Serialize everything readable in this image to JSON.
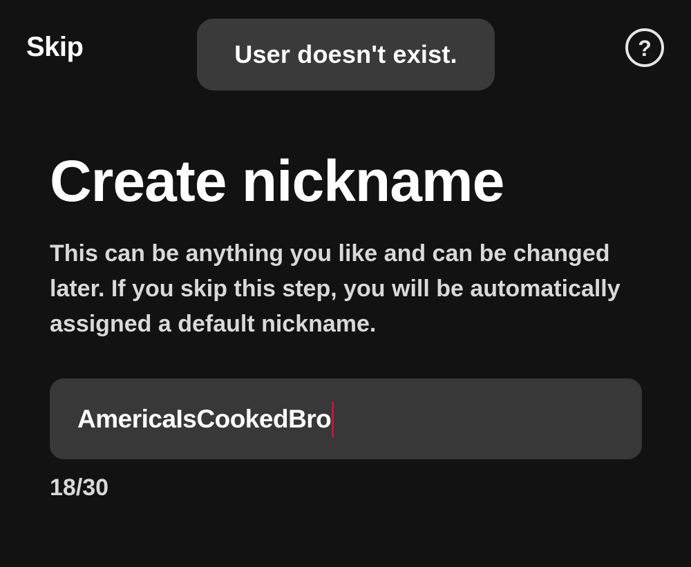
{
  "header": {
    "skip_label": "Skip",
    "help_icon": "question-circle-icon",
    "help_glyph": "?"
  },
  "toast": {
    "message": "User doesn't exist."
  },
  "main": {
    "title": "Create nickname",
    "description": "This can be anything you like and can be changed later. If you skip this step, you will be automatically assigned a default nickname.",
    "nickname_input": {
      "value": "AmericaIsCookedBro"
    },
    "char_counter": "18/30"
  },
  "colors": {
    "background": "#121212",
    "toast_background": "#3a3a3a",
    "input_background": "#383838",
    "caret": "#c0183f"
  }
}
